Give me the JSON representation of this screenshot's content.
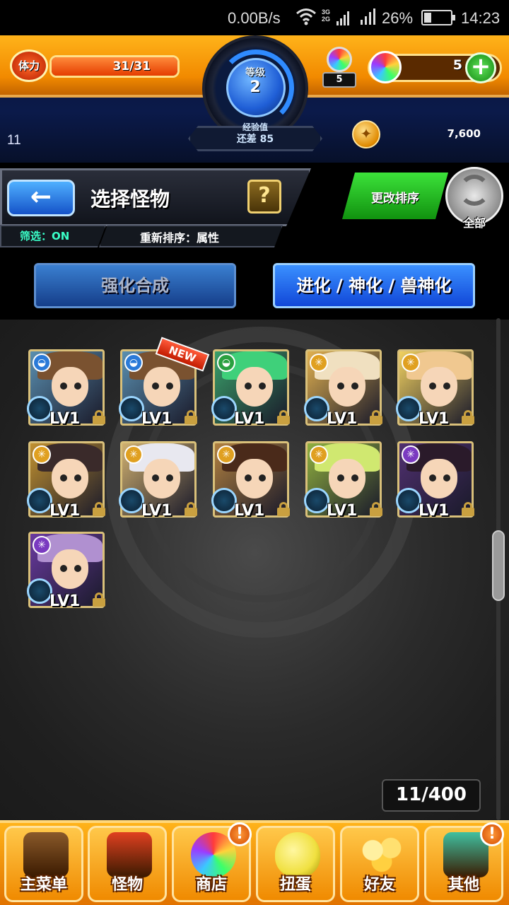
{
  "status_bar": {
    "net_speed": "0.00B/s",
    "network_type": "3G\n2G",
    "battery": "26%",
    "time": "14:23"
  },
  "hud": {
    "stamina_label": "体力",
    "stamina_value": "31/31",
    "stamina_fraction": 1.0,
    "level_label": "等级",
    "level_value": "2",
    "exp_label": "经验值",
    "exp_remaining": "还差 85",
    "hatch_count": "5",
    "stone_count": "5",
    "plus_label": "+",
    "left_number": "11",
    "coin_value": "7,600"
  },
  "header": {
    "back_label": "←",
    "title": "选择怪物",
    "help_label": "?",
    "filter_label": "筛选：ON",
    "sort_label": "重新排序：属性",
    "change_sort_label": "更改排序",
    "all_label": "全部"
  },
  "modes": {
    "upgrade_label": "强化合成",
    "evolve_label": "进化 / 神化 / 兽神化"
  },
  "monsters": [
    {
      "level": "LV1",
      "element": "water",
      "element_glyph": "◒",
      "new": false,
      "colors": {
        "bg": "#5a8fb0",
        "hair": "#7a5230"
      }
    },
    {
      "level": "LV1",
      "element": "water",
      "element_glyph": "◒",
      "new": true,
      "new_label": "NEW",
      "colors": {
        "bg": "#5a8fb0",
        "hair": "#7a5230"
      }
    },
    {
      "level": "LV1",
      "element": "wood",
      "element_glyph": "◒",
      "new": false,
      "colors": {
        "bg": "#3aa06a",
        "hair": "#3fd07a"
      }
    },
    {
      "level": "LV1",
      "element": "light",
      "element_glyph": "✳",
      "new": false,
      "colors": {
        "bg": "#e0b050",
        "hair": "#f0e0c0"
      }
    },
    {
      "level": "LV1",
      "element": "light",
      "element_glyph": "✳",
      "new": false,
      "colors": {
        "bg": "#f0d060",
        "hair": "#f0c890"
      }
    },
    {
      "level": "LV1",
      "element": "light",
      "element_glyph": "✳",
      "new": false,
      "colors": {
        "bg": "#c09030",
        "hair": "#3a2a2a"
      }
    },
    {
      "level": "LV1",
      "element": "light",
      "element_glyph": "✳",
      "new": false,
      "colors": {
        "bg": "#d0b070",
        "hair": "#e8e8f0"
      }
    },
    {
      "level": "LV1",
      "element": "light",
      "element_glyph": "✳",
      "new": false,
      "colors": {
        "bg": "#b08040",
        "hair": "#4a2a1a"
      }
    },
    {
      "level": "LV1",
      "element": "light",
      "element_glyph": "✳",
      "new": false,
      "colors": {
        "bg": "#90b040",
        "hair": "#d0e870"
      }
    },
    {
      "level": "LV1",
      "element": "dark",
      "element_glyph": "✳",
      "new": false,
      "colors": {
        "bg": "#503070",
        "hair": "#2a1a2a"
      }
    },
    {
      "level": "LV1",
      "element": "dark",
      "element_glyph": "✳",
      "new": false,
      "colors": {
        "bg": "#6a3aa0",
        "hair": "#b090d0"
      }
    }
  ],
  "element_colors": {
    "water": "#2a7ad8",
    "wood": "#2aa040",
    "light": "#e0a020",
    "dark": "#7a3ac0"
  },
  "box_count": "11/400",
  "nav": [
    {
      "id": "main",
      "label": "主菜单",
      "alert": false,
      "icon": "house-icon",
      "color": "#8a5a2a"
    },
    {
      "id": "monster",
      "label": "怪物",
      "alert": false,
      "icon": "monster-icon",
      "color": "#e04020"
    },
    {
      "id": "shop",
      "label": "商店",
      "alert": true,
      "alert_label": "!",
      "icon": "rainbow-orb-icon",
      "color": "#ffffff"
    },
    {
      "id": "gacha",
      "label": "扭蛋",
      "alert": false,
      "icon": "egg-icon",
      "color": "#f0e040"
    },
    {
      "id": "friends",
      "label": "好友",
      "alert": false,
      "icon": "balloons-icon",
      "color": "#ffd040"
    },
    {
      "id": "other",
      "label": "其他",
      "alert": true,
      "alert_label": "!",
      "icon": "question-box-icon",
      "color": "#40c0a0"
    }
  ]
}
